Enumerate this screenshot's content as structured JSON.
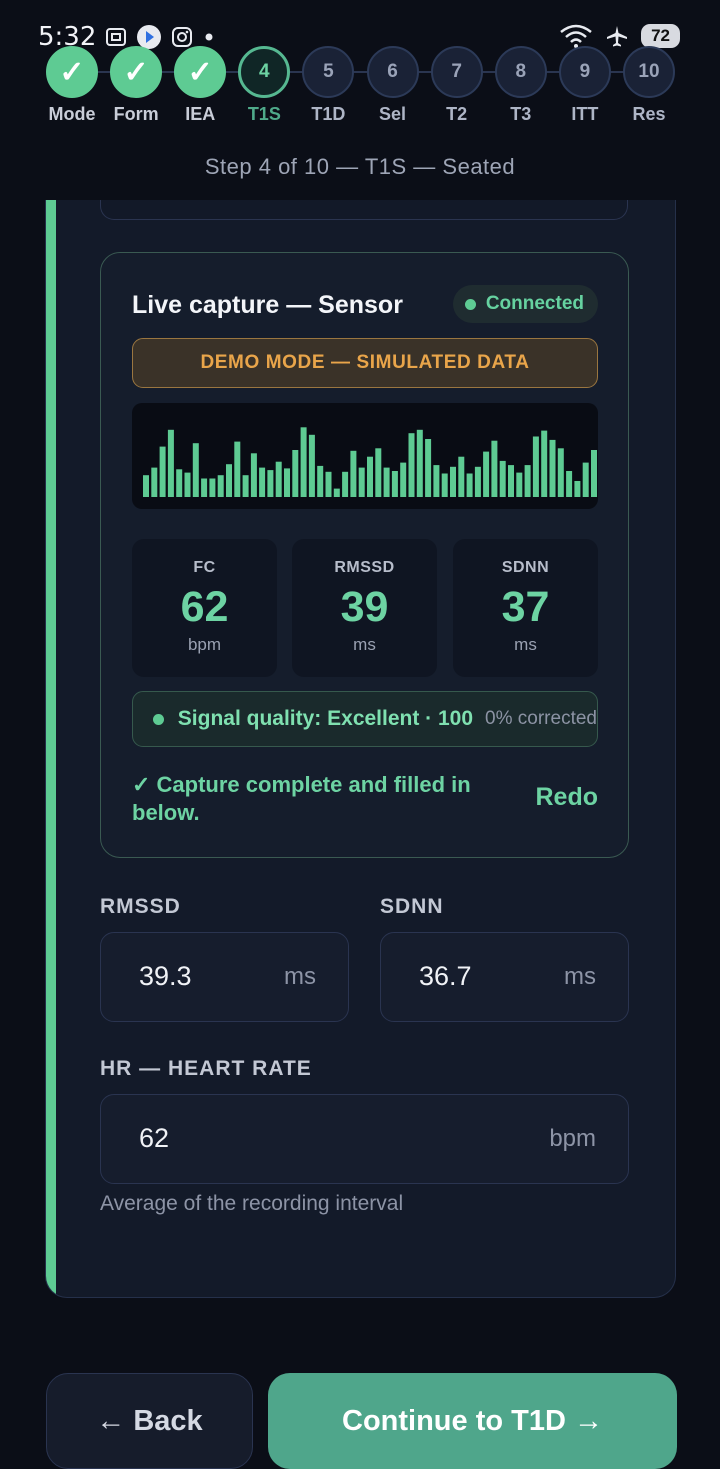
{
  "status_bar": {
    "time": "5:32",
    "battery": "72",
    "icons_left": [
      "screenshot-icon",
      "assistant-icon",
      "instagram-icon",
      "dot-icon"
    ],
    "icons_right": [
      "wifi-icon",
      "airplane-icon",
      "battery-icon"
    ]
  },
  "stepper": {
    "steps": [
      {
        "label": "Mode",
        "number": "1",
        "state": "done"
      },
      {
        "label": "Form",
        "number": "2",
        "state": "done"
      },
      {
        "label": "IEA",
        "number": "3",
        "state": "done"
      },
      {
        "label": "T1S",
        "number": "4",
        "state": "active"
      },
      {
        "label": "T1D",
        "number": "5",
        "state": "pending"
      },
      {
        "label": "Sel",
        "number": "6",
        "state": "pending"
      },
      {
        "label": "T2",
        "number": "7",
        "state": "pending"
      },
      {
        "label": "T3",
        "number": "8",
        "state": "pending"
      },
      {
        "label": "ITT",
        "number": "9",
        "state": "pending"
      },
      {
        "label": "Res",
        "number": "10",
        "state": "pending"
      }
    ],
    "done_mark": "✓",
    "caption": "Step 4 of 10 — T1S — Seated"
  },
  "capture": {
    "title": "Live capture — Sensor",
    "status": "Connected",
    "demo_banner": "DEMO MODE — SIMULATED DATA",
    "waveform": [
      0.26,
      0.35,
      0.6,
      0.8,
      0.33,
      0.29,
      0.64,
      0.22,
      0.22,
      0.26,
      0.39,
      0.66,
      0.26,
      0.52,
      0.35,
      0.32,
      0.42,
      0.34,
      0.56,
      0.83,
      0.74,
      0.37,
      0.3,
      0.1,
      0.3,
      0.55,
      0.35,
      0.48,
      0.58,
      0.35,
      0.31,
      0.41,
      0.76,
      0.8,
      0.69,
      0.38,
      0.28,
      0.36,
      0.48,
      0.28,
      0.36,
      0.54,
      0.67,
      0.43,
      0.38,
      0.29,
      0.38,
      0.72,
      0.79,
      0.68,
      0.58,
      0.31,
      0.19,
      0.41,
      0.56
    ],
    "metrics": [
      {
        "label": "FC",
        "value": "62",
        "unit": "bpm"
      },
      {
        "label": "RMSSD",
        "value": "39",
        "unit": "ms"
      },
      {
        "label": "SDNN",
        "value": "37",
        "unit": "ms"
      }
    ],
    "signal_quality": "Signal quality: Excellent · 100",
    "corrected": "0% corrected",
    "complete_message": "✓ Capture complete and filled in below.",
    "redo_label": "Redo"
  },
  "fields": {
    "rmssd": {
      "label": "RMSSD",
      "value": "39.3",
      "unit": "ms"
    },
    "sdnn": {
      "label": "SDNN",
      "value": "36.7",
      "unit": "ms"
    },
    "hr": {
      "label": "HR — HEART RATE",
      "value": "62",
      "unit": "bpm",
      "hint": "Average of the recording interval"
    }
  },
  "nav": {
    "back_label": "← Back",
    "continue_label": "Continue to T1D →"
  },
  "colors": {
    "accent_green": "#5ecb93",
    "primary_button": "#4fa68b",
    "warning_amber": "#e9a54a",
    "background": "#0b0e17"
  }
}
